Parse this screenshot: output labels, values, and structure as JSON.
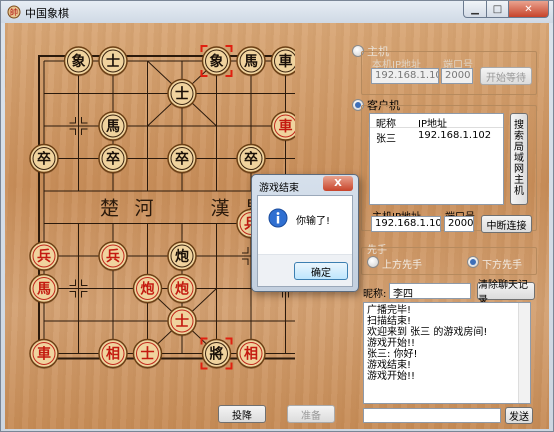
{
  "window": {
    "title": "中国象棋"
  },
  "board": {
    "river_text": [
      "楚",
      "河",
      "漢",
      "界"
    ],
    "pieces": [
      {
        "col": 1,
        "row": 0,
        "text": "象",
        "color": "black"
      },
      {
        "col": 2,
        "row": 0,
        "text": "士",
        "color": "black"
      },
      {
        "col": 5,
        "row": 0,
        "text": "象",
        "color": "black"
      },
      {
        "col": 6,
        "row": 0,
        "text": "馬",
        "color": "black"
      },
      {
        "col": 7,
        "row": 0,
        "text": "車",
        "color": "black"
      },
      {
        "col": 4,
        "row": 1,
        "text": "士",
        "color": "black"
      },
      {
        "col": 2,
        "row": 2,
        "text": "馬",
        "color": "black"
      },
      {
        "col": 7,
        "row": 2,
        "text": "車",
        "color": "red"
      },
      {
        "col": 0,
        "row": 3,
        "text": "卒",
        "color": "black"
      },
      {
        "col": 2,
        "row": 3,
        "text": "卒",
        "color": "black"
      },
      {
        "col": 4,
        "row": 3,
        "text": "卒",
        "color": "black"
      },
      {
        "col": 6,
        "row": 3,
        "text": "卒",
        "color": "black"
      },
      {
        "col": 8,
        "row": 3,
        "text": "卒",
        "color": "black"
      },
      {
        "col": 6,
        "row": 5,
        "text": "兵",
        "color": "red"
      },
      {
        "col": 0,
        "row": 6,
        "text": "兵",
        "color": "red"
      },
      {
        "col": 2,
        "row": 6,
        "text": "兵",
        "color": "red"
      },
      {
        "col": 4,
        "row": 6,
        "text": "炮",
        "color": "black"
      },
      {
        "col": 0,
        "row": 7,
        "text": "馬",
        "color": "red"
      },
      {
        "col": 3,
        "row": 7,
        "text": "炮",
        "color": "red"
      },
      {
        "col": 4,
        "row": 7,
        "text": "炮",
        "color": "red"
      },
      {
        "col": 4,
        "row": 8,
        "text": "士",
        "color": "red"
      },
      {
        "col": 0,
        "row": 9,
        "text": "車",
        "color": "red"
      },
      {
        "col": 2,
        "row": 9,
        "text": "相",
        "color": "red"
      },
      {
        "col": 3,
        "row": 9,
        "text": "士",
        "color": "red"
      },
      {
        "col": 5,
        "row": 9,
        "text": "將",
        "color": "black"
      },
      {
        "col": 6,
        "row": 9,
        "text": "相",
        "color": "red"
      }
    ],
    "selection_markers": [
      {
        "col": 5,
        "row": 0
      },
      {
        "col": 5,
        "row": 9
      }
    ]
  },
  "server": {
    "label": "主机",
    "ip_label": "本机IP地址",
    "port_label": "端口号",
    "ip": "192.168.1.102",
    "port": "2000",
    "start_button": "开始等待"
  },
  "client": {
    "label": "客户机",
    "columns": [
      "昵称",
      "IP地址"
    ],
    "rows": [
      {
        "nick": "张三",
        "ip": "192.168.1.102"
      }
    ],
    "search_button": "搜索局域网主机",
    "host_ip_label": "主机IP地址",
    "port_label": "端口号",
    "host_ip": "192.168.1.102",
    "port": "2000",
    "disconnect_button": "中断连接"
  },
  "first_move": {
    "group_label": "先手",
    "top_option": "上方先手",
    "bottom_option": "下方先手",
    "selected": "bottom"
  },
  "chat": {
    "nick_label": "昵称:",
    "nick_value": "李四",
    "clear_button": "清除聊天记录",
    "lines": [
      "广播完毕!",
      "扫描结束!",
      "欢迎来到 张三 的游戏房间!",
      "游戏开始!!",
      "张三: 你好!",
      "游戏结束!",
      "游戏开始!!"
    ],
    "input_value": "",
    "send_button": "发送"
  },
  "bottom_buttons": {
    "resign": "投降",
    "ready": "准备"
  },
  "dialog": {
    "title": "游戏结束",
    "message": "你输了!",
    "ok_button": "确定",
    "close_label": "X"
  }
}
